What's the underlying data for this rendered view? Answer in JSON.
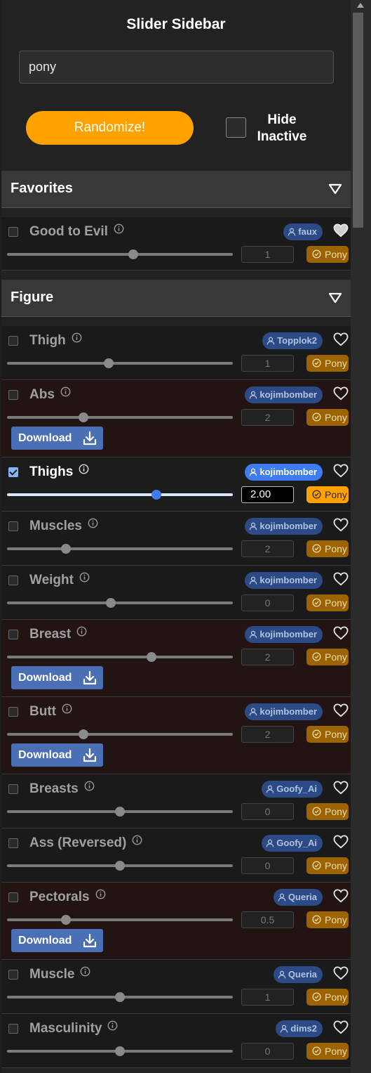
{
  "app": {
    "title": "Slider Sidebar",
    "search_value": "pony",
    "randomize_label": "Randomize!",
    "hide_inactive_line1": "Hide",
    "hide_inactive_line2": "Inactive",
    "download_label": "Download"
  },
  "sections": [
    {
      "title": "Favorites"
    },
    {
      "title": "Figure"
    }
  ],
  "colors": {
    "accent": "#ffa200",
    "author_badge": "#2c4a86",
    "author_badge_active": "#3e7cf0",
    "download": "#4a6fb5",
    "red_row": "#231414"
  },
  "favorites": [
    {
      "name": "Good to Evil",
      "author": "faux",
      "value": "1",
      "base": "Pony",
      "slider_fraction": 0.56,
      "checked": false,
      "favorited": true
    }
  ],
  "figure": [
    {
      "name": "Thigh",
      "author": "Topplok2",
      "value": "1",
      "base": "Pony",
      "slider_fraction": 0.45,
      "checked": false,
      "download": false
    },
    {
      "name": "Abs",
      "author": "kojimbomber",
      "value": "2",
      "base": "Pony",
      "slider_fraction": 0.34,
      "checked": false,
      "download": true
    },
    {
      "name": "Thighs",
      "author": "kojimbomber",
      "value": "2.00",
      "base": "Pony",
      "slider_fraction": 0.66,
      "checked": true,
      "download": false
    },
    {
      "name": "Muscles",
      "author": "kojimbomber",
      "value": "2",
      "base": "Pony",
      "slider_fraction": 0.26,
      "checked": false,
      "download": false
    },
    {
      "name": "Weight",
      "author": "kojimbomber",
      "value": "0",
      "base": "Pony",
      "slider_fraction": 0.46,
      "checked": false,
      "download": false
    },
    {
      "name": "Breast",
      "author": "kojimbomber",
      "value": "2",
      "base": "Pony",
      "slider_fraction": 0.64,
      "checked": false,
      "download": true
    },
    {
      "name": "Butt",
      "author": "kojimbomber",
      "value": "2",
      "base": "Pony",
      "slider_fraction": 0.34,
      "checked": false,
      "download": true
    },
    {
      "name": "Breasts",
      "author": "Goofy_Ai",
      "value": "0",
      "base": "Pony",
      "slider_fraction": 0.5,
      "checked": false,
      "download": false
    },
    {
      "name": "Ass (Reversed)",
      "author": "Goofy_Ai",
      "value": "0",
      "base": "Pony",
      "slider_fraction": 0.5,
      "checked": false,
      "download": false
    },
    {
      "name": "Pectorals",
      "author": "Queria",
      "value": "0.5",
      "base": "Pony",
      "slider_fraction": 0.26,
      "checked": false,
      "download": true
    },
    {
      "name": "Muscle",
      "author": "Queria",
      "value": "1",
      "base": "Pony",
      "slider_fraction": 0.5,
      "checked": false,
      "download": false
    },
    {
      "name": "Masculinity",
      "author": "dims2",
      "value": "0",
      "base": "Pony",
      "slider_fraction": 0.5,
      "checked": false,
      "download": false
    }
  ]
}
